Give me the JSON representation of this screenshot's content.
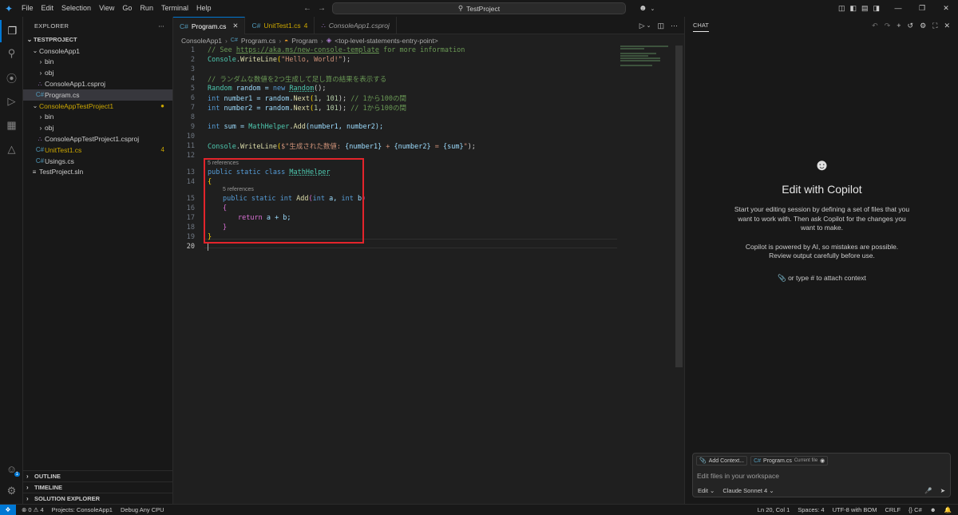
{
  "titlebar": {
    "menu": [
      "File",
      "Edit",
      "Selection",
      "View",
      "Go",
      "Run",
      "Terminal",
      "Help"
    ],
    "search": "TestProject"
  },
  "sidebar": {
    "title": "EXPLORER",
    "items": [
      {
        "label": "TESTPROJECT"
      },
      {
        "label": "ConsoleApp1"
      },
      {
        "label": "bin"
      },
      {
        "label": "obj"
      },
      {
        "label": "ConsoleApp1.csproj"
      },
      {
        "label": "Program.cs"
      },
      {
        "label": "ConsoleAppTestProject1"
      },
      {
        "label": "bin"
      },
      {
        "label": "obj"
      },
      {
        "label": "ConsoleAppTestProject1.csproj"
      },
      {
        "label": "UnitTest1.cs",
        "badge": "4"
      },
      {
        "label": "Usings.cs"
      },
      {
        "label": "TestProject.sln"
      }
    ],
    "sections": [
      "OUTLINE",
      "TIMELINE",
      "SOLUTION EXPLORER"
    ],
    "account_badge": "1"
  },
  "editor": {
    "tabs": [
      {
        "label": "Program.cs"
      },
      {
        "label": "UnitTest1.cs",
        "badge": "4"
      },
      {
        "label": "ConsoleApp1.csproj"
      }
    ],
    "breadcrumb": [
      "ConsoleApp1",
      "Program.cs",
      "Program",
      "<top-level-statements-entry-point>"
    ],
    "codelens": "5 references",
    "line_numbers": [
      "1",
      "2",
      "3",
      "4",
      "5",
      "6",
      "7",
      "8",
      "9",
      "10",
      "11",
      "12",
      "13",
      "14",
      "15",
      "16",
      "17",
      "18",
      "19",
      "20"
    ],
    "code": {
      "l1_a": "// See ",
      "l1_url": "https://aka.ms/new-console-template",
      "l1_b": " for more information",
      "l2_a": "Console",
      "l2_b": ".",
      "l2_c": "WriteLine",
      "l2_d": "(",
      "l2_e": "\"Hello, World!\"",
      "l2_f": ");",
      "l4": "// ランダムな数値を2つ生成して足し算の結果を表示する",
      "l5_a": "Random",
      "l5_b": " random = ",
      "l5_c": "new",
      "l5_d": "Random",
      "l5_e": "();",
      "l6_a": "int",
      "l6_b": " number1 = random.",
      "l6_c": "Next",
      "l6_d": "(",
      "l6_e": "1",
      "l6_f": ", ",
      "l6_g": "101",
      "l6_h": "); ",
      "l6_i": "// 1から100の間",
      "l7_a": "int",
      "l7_b": " number2 = random.",
      "l7_c": "Next",
      "l7_d": "(",
      "l7_e": "1",
      "l7_f": ", ",
      "l7_g": "101",
      "l7_h": "); ",
      "l7_i": "// 1から100の間",
      "l9_a": "int",
      "l9_b": " sum = ",
      "l9_c": "MathHelper",
      "l9_d": ".",
      "l9_e": "Add",
      "l9_f": "(number1, number2);",
      "l11_a": "Console",
      "l11_b": ".",
      "l11_c": "WriteLine",
      "l11_d": "(",
      "l11_e": "$\"生成された数値: ",
      "l11_f": "{number1}",
      "l11_g": " + ",
      "l11_h": "{number2}",
      "l11_i": " = ",
      "l11_j": "{sum}",
      "l11_k": "\"",
      "l11_l": ");",
      "l13_a": "public",
      "l13_b": "static",
      "l13_c": "class",
      "l13_d": "MathHelper",
      "l14": "{",
      "l15_a": "public",
      "l15_b": "static",
      "l15_c": "int",
      "l15_d": "Add",
      "l15_e": "(",
      "l15_f": "int",
      "l15_g": " a, ",
      "l15_h": "int",
      "l15_i": " b",
      "l15_j": ")",
      "l16": "{",
      "l17_a": "return",
      "l17_b": " a + b;",
      "l18": "}",
      "l19": "}"
    }
  },
  "chat": {
    "tab": "CHAT",
    "title": "Edit with Copilot",
    "para1": "Start your editing session by defining a set of files that you want to work with. Then ask Copilot for the changes you want to make.",
    "para2": "Copilot is powered by AI, so mistakes are possible. Review output carefully before use.",
    "attach_hint": "or type # to attach context",
    "add_context": "Add Context...",
    "file_chip": "Program.cs",
    "file_chip_note": "Current file",
    "placeholder": "Edit files in your workspace",
    "mode": "Edit",
    "model": "Claude Sonnet 4"
  },
  "statusbar": {
    "problems_errors": "0",
    "problems_warnings": "4",
    "projects": "Projects: ConsoleApp1",
    "debug": "Debug Any CPU",
    "position": "Ln 20, Col 1",
    "spaces": "Spaces: 4",
    "encoding": "UTF-8 with BOM",
    "eol": "CRLF",
    "language": "C#"
  },
  "colors": {
    "accent": "#0078d4",
    "highlight_box": "#e3242b",
    "warning": "#cca700"
  }
}
